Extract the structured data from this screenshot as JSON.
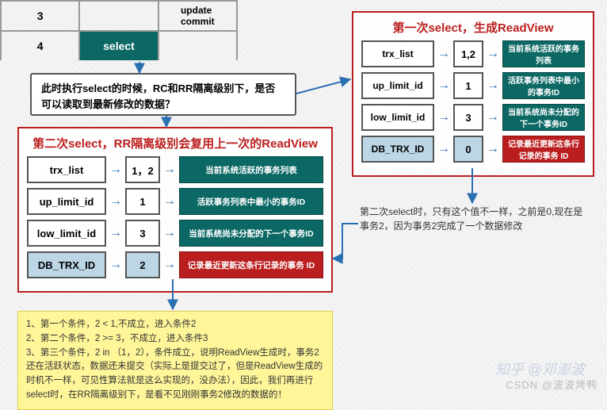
{
  "top_table": {
    "rows": [
      {
        "col1": "3",
        "col2": "",
        "col3": "update\ncommit"
      },
      {
        "col1": "4",
        "col2": "select",
        "col3": ""
      }
    ],
    "highlight_col2_row": 1
  },
  "question": "此时执行select的时候，RC和RR隔离级别下，是否可以读取到最新修改的数据？",
  "readview_left": {
    "title": "第二次select，RR隔离级别会复用上一次的ReadView",
    "rows": [
      {
        "name": "trx_list",
        "value": "1，2",
        "desc": "当前系统活跃的事务列表"
      },
      {
        "name": "up_limit_id",
        "value": "1",
        "desc": "活跃事务列表中最小的事务ID"
      },
      {
        "name": "low_limit_id",
        "value": "3",
        "desc": "当前系统尚未分配的下一个事务ID"
      },
      {
        "name": "DB_TRX_ID",
        "value": "2",
        "desc": "记录最近更新这条行记录的事务 ID",
        "highlight": true
      }
    ]
  },
  "readview_right": {
    "title": "第一次select，生成ReadView",
    "rows": [
      {
        "name": "trx_list",
        "value": "1,2",
        "desc": "当前系统活跃的事务列表"
      },
      {
        "name": "up_limit_id",
        "value": "1",
        "desc": "活跃事务列表中最小的事务ID"
      },
      {
        "name": "low_limit_id",
        "value": "3",
        "desc": "当前系统尚未分配的下一个事务ID"
      },
      {
        "name": "DB_TRX_ID",
        "value": "0",
        "desc": "记录最近更新这条行记录的事务 ID",
        "highlight": true
      }
    ]
  },
  "note_right": "第二次select时，只有这个值不一样，之前是0,现在是事务2，因为事务2完成了一个数据修改",
  "yellow_steps": "1、第一个条件，2 < 1,不成立，进入条件2\n2、第二个条件，2 >= 3，不成立，进入条件3\n3、第三个条件，2 in （1，2），条件成立，说明ReadView生成时，事务2还在活跃状态，数据还未提交（实际上是提交过了，但是ReadView生成的时机不一样，可见性算法就是这么实现的，没办法），因此，我们再进行select时，在RR隔离级别下，是看不见刚刚事务2修改的数据的！",
  "watermarks": {
    "zhihu": "知乎 @邓澎波",
    "csdn": "CSDN @波波烤鸭"
  }
}
